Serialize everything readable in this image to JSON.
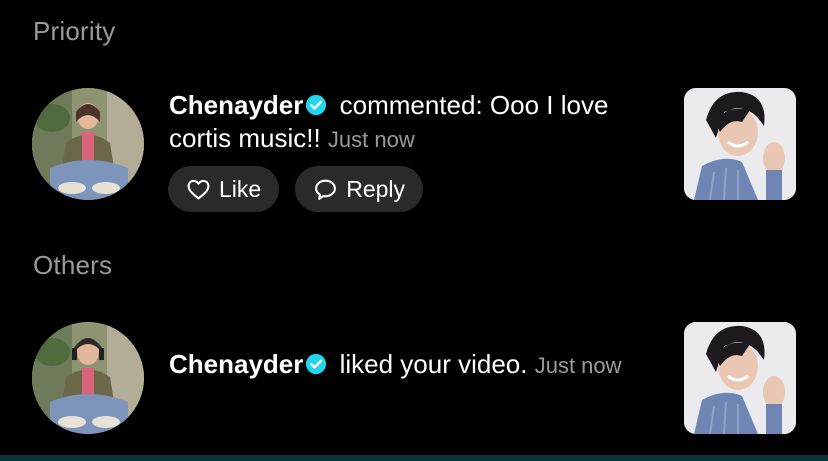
{
  "sections": {
    "priority": "Priority",
    "others": "Others"
  },
  "notifications": [
    {
      "username": "Chenayder",
      "verified": true,
      "action": " commented: Ooo I love cortis music!! ",
      "time": "Just now",
      "actions": {
        "like_label": "Like",
        "reply_label": "Reply"
      }
    },
    {
      "username": "Chenayder",
      "verified": true,
      "action": " liked your video. ",
      "time": "Just now"
    }
  ],
  "colors": {
    "verified_badge": "#20d5ec",
    "secondary_text": "#9a9a9a",
    "pill_background": "#2a2a2a"
  },
  "icons": {
    "like": "heart-outline-icon",
    "reply": "speech-bubble-icon",
    "verified": "verified-check-badge-icon"
  }
}
